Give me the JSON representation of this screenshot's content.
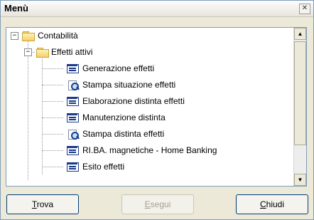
{
  "window": {
    "title": "Menù",
    "close_glyph": "✕"
  },
  "tree": {
    "root": {
      "label": "Contabilità",
      "expander": "−",
      "icon": "folder-icon"
    },
    "group": {
      "label": "Effetti attivi",
      "expander": "−",
      "icon": "folder-icon"
    },
    "items": [
      {
        "label": "Generazione effetti",
        "icon": "form-icon"
      },
      {
        "label": "Stampa situazione effetti",
        "icon": "print-preview-icon"
      },
      {
        "label": "Elaborazione distinta effetti",
        "icon": "form-icon"
      },
      {
        "label": "Manutenzione distinta",
        "icon": "form-icon"
      },
      {
        "label": "Stampa distinta effetti",
        "icon": "print-preview-icon"
      },
      {
        "label": "RI.BA. magnetiche - Home Banking",
        "icon": "form-icon"
      },
      {
        "label": "Esito effetti",
        "icon": "form-icon"
      }
    ]
  },
  "scrollbar": {
    "up_glyph": "▲",
    "down_glyph": "▼"
  },
  "buttons": {
    "find": {
      "accel": "T",
      "rest": "rova"
    },
    "run": {
      "accel": "E",
      "rest": "segui",
      "disabled": true
    },
    "close": {
      "accel": "C",
      "rest": "hiudi"
    }
  }
}
